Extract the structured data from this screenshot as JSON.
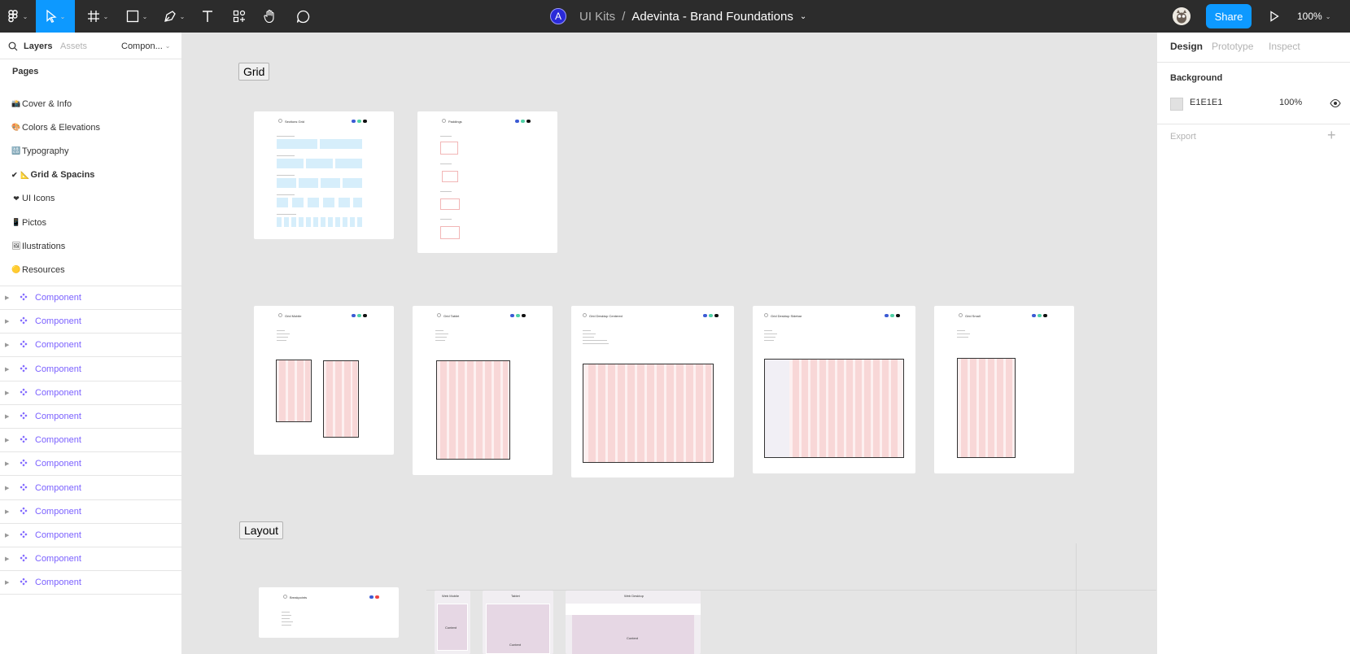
{
  "toolbar": {
    "team_initial": "A",
    "team": "UI Kits",
    "separator": "/",
    "file_name": "Adevinta - Brand Foundations",
    "share_label": "Share",
    "zoom": "100%",
    "tools": [
      "main-menu-icon",
      "move-tool-icon",
      "frame-tool-icon",
      "shape-tool-icon",
      "pen-tool-icon",
      "text-tool-icon",
      "resources-icon",
      "hand-tool-icon",
      "comment-icon"
    ]
  },
  "left_panel": {
    "tabs": {
      "layers": "Layers",
      "assets": "Assets",
      "component": "Compon..."
    },
    "pages_title": "Pages",
    "pages": [
      {
        "emoji": "📸",
        "label": "Cover & Info"
      },
      {
        "emoji": "🎨",
        "label": "Colors & Elevations"
      },
      {
        "emoji": "🔠",
        "label": "Typography"
      },
      {
        "emoji": "📐",
        "label": "Grid & Spacins",
        "check": "✔"
      },
      {
        "emoji": "❤",
        "label": "UI Icons"
      },
      {
        "emoji": "📱",
        "label": "Pictos"
      },
      {
        "emoji": "🖼",
        "label": "Ilustrations"
      },
      {
        "emoji": "🟡",
        "label": "Resources"
      }
    ],
    "layers": [
      "Component",
      "Component",
      "Component",
      "Component",
      "Component",
      "Component",
      "Component",
      "Component",
      "Component",
      "Component",
      "Component",
      "Component",
      "Component"
    ]
  },
  "canvas": {
    "grid_label": "Grid",
    "layout_label": "Layout",
    "frames": {
      "sections_grid": "Sections Grid",
      "paddings": "Paddings",
      "grid_mobile": "Grid Mobile",
      "grid_tablet": "Grid Tablet",
      "grid_desktop_centered": "Grid Desktop Centered",
      "grid_desktop_sidebar": "Grid Desktop Sidebar",
      "grid_small": "Grid Small",
      "breakpoints": "Breakpoints"
    },
    "layout_sections": {
      "mobile": "Web Mobile",
      "tablet": "Tablet",
      "desktop": "Web Desktop",
      "content": "Content"
    }
  },
  "right_panel": {
    "tabs": {
      "design": "Design",
      "prototype": "Prototype",
      "inspect": "Inspect"
    },
    "background_title": "Background",
    "bg_hex": "E1E1E1",
    "bg_opacity": "100%",
    "export_title": "Export",
    "add_symbol": "+"
  },
  "colors": {
    "accent": "#0d99ff",
    "component": "#7b61ff",
    "toolbar": "#2c2c2c",
    "canvas": "#e5e5e5"
  }
}
